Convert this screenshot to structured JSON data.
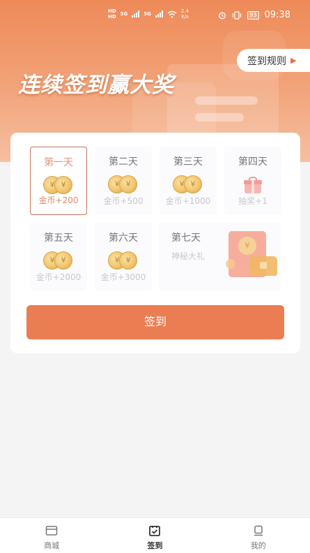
{
  "status_bar": {
    "network_left_top": "HD",
    "network_left_bottom": "HD",
    "signal1": "5G",
    "signal2": "5G",
    "speed": "2.4",
    "speed_unit": "K/s",
    "battery": "93",
    "time": "09:38"
  },
  "banner": {
    "title": "连续签到赢大奖",
    "rules_label": "签到规则"
  },
  "days": [
    {
      "title": "第一天",
      "reward": "金币+200",
      "icon": "coins-icon",
      "active": true
    },
    {
      "title": "第二天",
      "reward": "金币+500",
      "icon": "coins-icon",
      "active": false
    },
    {
      "title": "第三天",
      "reward": "金币+1000",
      "icon": "coins-icon",
      "active": false
    },
    {
      "title": "第四天",
      "reward": "抽奖+1",
      "icon": "gift-icon",
      "active": false
    },
    {
      "title": "第五天",
      "reward": "金币+2000",
      "icon": "coins-icon",
      "active": false
    },
    {
      "title": "第六天",
      "reward": "金币+3000",
      "icon": "coins-icon",
      "active": false
    }
  ],
  "day7": {
    "title": "第七天",
    "reward": "神秘大礼",
    "icon": "mystery-gift-icon"
  },
  "coin_symbol": "¥",
  "signin_button": "签到",
  "bottom_nav": [
    {
      "label": "商城",
      "icon": "store-icon",
      "active": false
    },
    {
      "label": "签到",
      "icon": "checkin-icon",
      "active": true
    },
    {
      "label": "我的",
      "icon": "profile-icon",
      "active": false
    }
  ],
  "colors": {
    "accent": "#ea7d51",
    "header_top": "#ee8a58",
    "active_border": "#c8745a"
  }
}
